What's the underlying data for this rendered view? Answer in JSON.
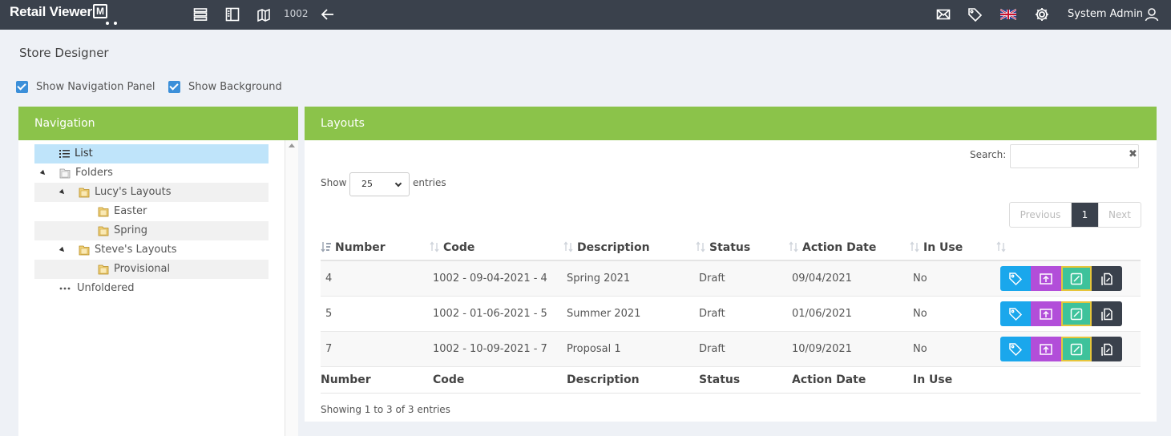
{
  "app": {
    "brand": "Retail Viewer",
    "brand_mark": "M",
    "store_number": "1002",
    "user": "System Admin"
  },
  "page": {
    "title": "Store Designer",
    "show_navigation_panel": "Show Navigation Panel",
    "show_background": "Show Background"
  },
  "navigation": {
    "title": "Navigation",
    "tree": [
      {
        "label": "List",
        "icon": "list-icon",
        "selected": true
      },
      {
        "label": "Folders",
        "icon": "folder-icon"
      },
      {
        "label": "Lucy's Layouts",
        "icon": "folder-icon"
      },
      {
        "label": "Easter",
        "icon": "folder-icon"
      },
      {
        "label": "Spring",
        "icon": "folder-icon"
      },
      {
        "label": "Steve's Layouts",
        "icon": "folder-icon"
      },
      {
        "label": "Provisional",
        "icon": "folder-icon"
      },
      {
        "label": "Unfoldered",
        "icon": "ellipsis-icon"
      }
    ]
  },
  "layouts": {
    "title": "Layouts",
    "search_label": "Search:",
    "search_value": "",
    "show_label": "Show",
    "page_length": "25",
    "entries_label": "entries",
    "pager": {
      "previous": "Previous",
      "current": "1",
      "next": "Next"
    },
    "columns": [
      "Number",
      "Code",
      "Description",
      "Status",
      "Action Date",
      "In Use"
    ],
    "rows": [
      {
        "number": "4",
        "code": "1002 - 09-04-2021 - 4",
        "description": "Spring 2021",
        "status": "Draft",
        "action_date": "09/04/2021",
        "in_use": "No"
      },
      {
        "number": "5",
        "code": "1002 - 01-06-2021 - 5",
        "description": "Summer 2021",
        "status": "Draft",
        "action_date": "01/06/2021",
        "in_use": "No"
      },
      {
        "number": "7",
        "code": "1002 - 10-09-2021 - 7",
        "description": "Proposal 1",
        "status": "Draft",
        "action_date": "10/09/2021",
        "in_use": "No"
      }
    ],
    "info": "Showing 1 to 3 of 3 entries"
  },
  "colors": {
    "topbar": "#3a414c",
    "panel_header": "#8bc34a",
    "selected_row": "#bfe4fa",
    "action_tag": "#1aa7ec",
    "action_publish": "#b24ed9",
    "action_edit": "#3ec29b",
    "action_copy": "#3a414c"
  }
}
